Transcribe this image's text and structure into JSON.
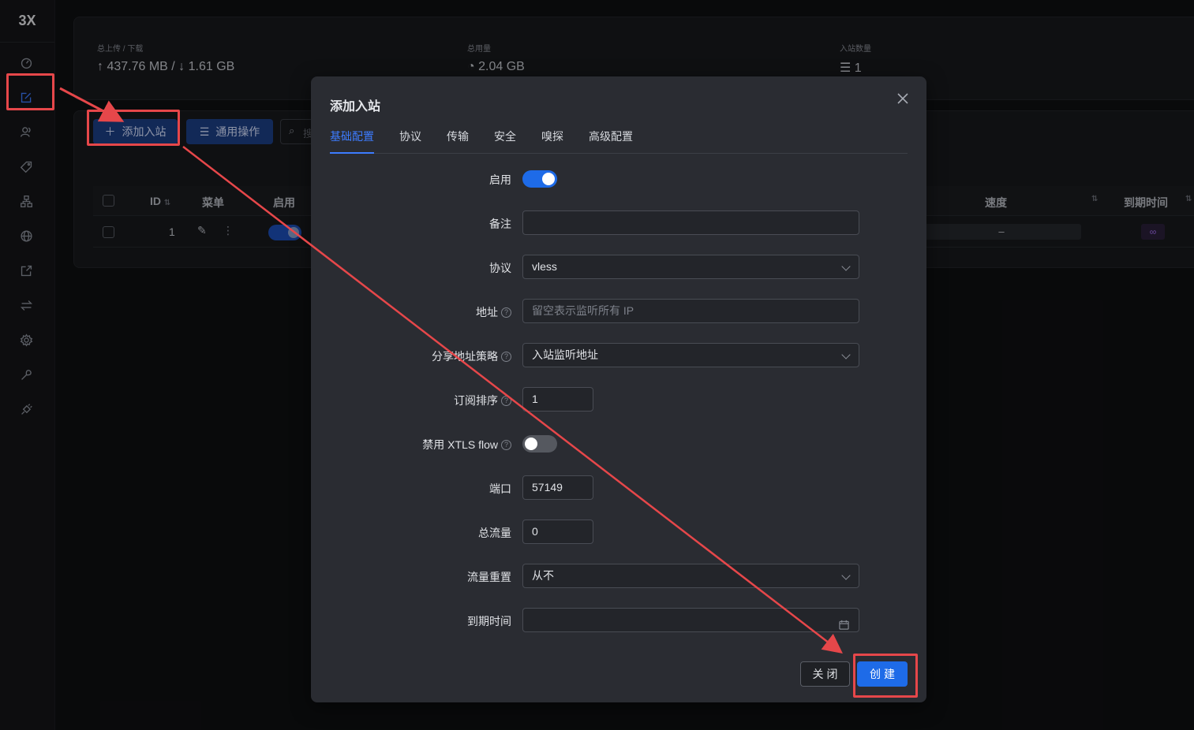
{
  "app": {
    "logo": "3X"
  },
  "sidebar": {
    "items": [
      {
        "icon": "dashboard-icon"
      },
      {
        "icon": "inbounds-icon"
      },
      {
        "icon": "users-icon"
      },
      {
        "icon": "tag-icon"
      },
      {
        "icon": "network-icon"
      },
      {
        "icon": "globe-icon"
      },
      {
        "icon": "export-icon"
      },
      {
        "icon": "transfer-icon"
      },
      {
        "icon": "settings-icon"
      },
      {
        "icon": "tools-icon"
      },
      {
        "icon": "plugin-icon"
      }
    ]
  },
  "stats": {
    "traffic_label": "总上传 / 下载",
    "traffic_value": "↑ 437.76 MB / ↓ 1.61 GB",
    "usage_label": "总用量",
    "usage_value": "◔ 2.04 GB",
    "inbound_count_label": "入站数量",
    "inbound_count_value": "☰ 1"
  },
  "toolbar": {
    "add_label": "添加入站",
    "ops_label": "通用操作",
    "search_placeholder": "搜"
  },
  "table": {
    "columns": {
      "id": "ID",
      "menu": "菜单",
      "enable": "启用",
      "speed": "速度",
      "expiry": "到期时间"
    },
    "rows": [
      {
        "id": "1",
        "speed": "–",
        "expiry": "∞"
      }
    ]
  },
  "modal": {
    "title": "添加入站",
    "tabs": [
      "基础配置",
      "协议",
      "传输",
      "安全",
      "嗅探",
      "高级配置"
    ],
    "fields": {
      "enable_label": "启用",
      "enable_value": true,
      "remark_label": "备注",
      "remark_value": "",
      "protocol_label": "协议",
      "protocol_value": "vless",
      "address_label": "地址",
      "address_placeholder": "留空表示监听所有 IP",
      "share_strategy_label": "分享地址策略",
      "share_strategy_value": "入站监听地址",
      "sub_order_label": "订阅排序",
      "sub_order_value": "1",
      "disable_xtls_label": "禁用 XTLS flow",
      "disable_xtls_value": false,
      "port_label": "端口",
      "port_value": "57149",
      "total_traffic_label": "总流量",
      "total_traffic_value": "0",
      "traffic_reset_label": "流量重置",
      "traffic_reset_value": "从不",
      "expiry_label": "到期时间",
      "expiry_value": ""
    },
    "close_label": "关闭",
    "create_label": "创建"
  },
  "colors": {
    "accent": "#1e6be8",
    "annotation": "#e6474a"
  }
}
